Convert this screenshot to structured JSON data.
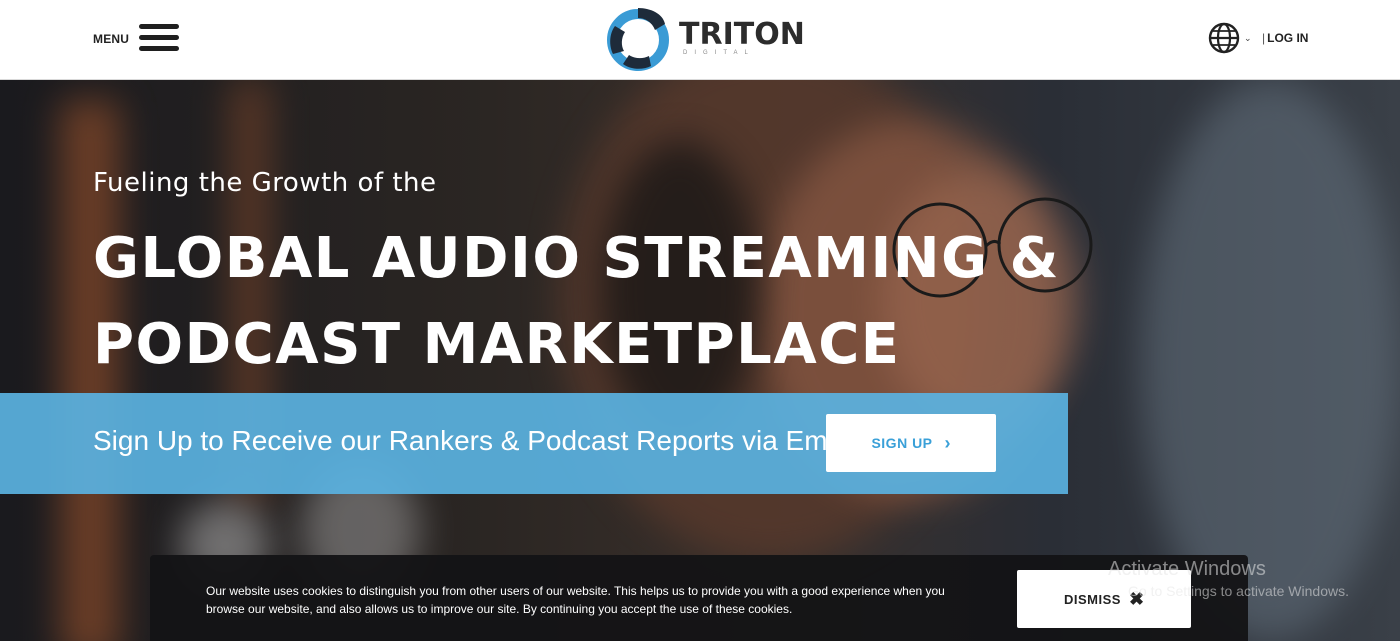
{
  "header": {
    "menu_label": "MENU",
    "logo_text": "TRITON",
    "logo_sub": "DIGITAL",
    "login_label": "LOG IN"
  },
  "hero": {
    "tagline": "Fueling the Growth of the",
    "headline_line1": "GLOBAL AUDIO STREAMING &",
    "headline_line2": "PODCAST MARKETPLACE",
    "signup_text": "Sign Up to Receive our Rankers & Podcast Reports via Email",
    "signup_button": "SIGN UP"
  },
  "cookie": {
    "text": "Our website uses cookies to distinguish you from other users of our website. This helps us to provide you with a good experience when you browse our website, and also allows us to improve our site. By continuing you accept the use of these cookies.",
    "dismiss_label": "DISMISS"
  },
  "watermark": {
    "line1": "Activate Windows",
    "line2": "Go to Settings to activate Windows."
  },
  "colors": {
    "accent_blue": "#5ab2e1",
    "logo_blue": "#3a9bd5",
    "header_bg": "#ffffff",
    "banner_bg": "#141416"
  },
  "icons": {
    "menu": "hamburger-icon",
    "globe": "globe-icon",
    "chevron": "chevron-down-icon",
    "arrow": "chevron-right-icon",
    "close": "close-icon"
  }
}
